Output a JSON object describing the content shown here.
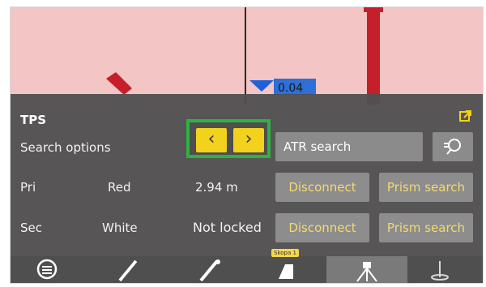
{
  "scene": {
    "value_label": "0.04",
    "colors": {
      "background": "#f3c5c5",
      "panel": "#505050",
      "highlight": "#2db342",
      "accent_yellow": "#f2d21d"
    }
  },
  "panel": {
    "title": "TPS",
    "popout_icon": "external-link-icon",
    "search_options_label": "Search options",
    "prev_icon": "chevron-left-icon",
    "next_icon": "chevron-right-icon",
    "search_mode_value": "ATR search",
    "search_mode_icon": "prism-search-icon",
    "pri": {
      "label": "Pri",
      "color": "Red",
      "distance": "2.94 m",
      "disconnect_label": "Disconnect",
      "prism_search_label": "Prism search"
    },
    "sec": {
      "label": "Sec",
      "color": "White",
      "status": "Not locked",
      "disconnect_label": "Disconnect",
      "prism_search_label": "Prism search"
    }
  },
  "bottom_bar": {
    "tabs": [
      {
        "name": "menu",
        "icon": "menu-circle-icon"
      },
      {
        "name": "tool-1",
        "icon": "pencil-tool-icon"
      },
      {
        "name": "tool-2",
        "icon": "pencil-tool-2-icon"
      },
      {
        "name": "bucket",
        "icon": "bucket-icon",
        "tag": "Skopa 1"
      },
      {
        "name": "total-station",
        "icon": "total-station-icon",
        "active": true
      },
      {
        "name": "location",
        "icon": "location-pin-icon"
      }
    ]
  }
}
